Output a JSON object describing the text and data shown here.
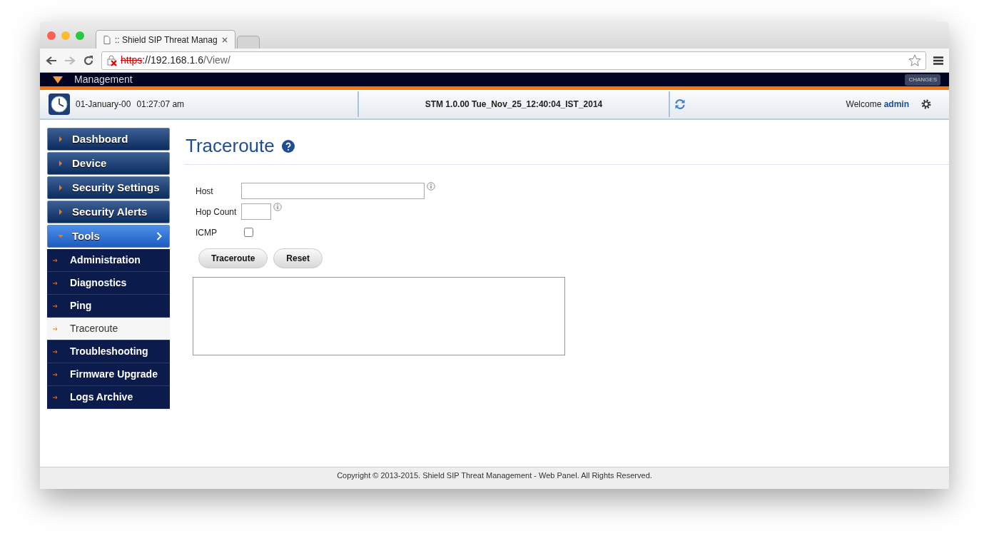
{
  "browser": {
    "tabs": [
      {
        "title": ":: Shield SIP Threat Manag",
        "selected": true
      },
      {
        "selected": false
      }
    ],
    "url": {
      "scheme": "https",
      "host": "://192.168.1.6",
      "path": "/View/"
    }
  },
  "header": {
    "brand": "Management",
    "changes_button": "CHANGES"
  },
  "info_bar": {
    "date": "01-January-00",
    "time": "01:27:07 am",
    "version": "STM 1.0.00 Tue_Nov_25_12:40:04_IST_2014",
    "welcome": "Welcome",
    "user": "admin"
  },
  "sidebar": {
    "items": [
      {
        "label": "Dashboard",
        "expanded": false
      },
      {
        "label": "Device",
        "expanded": false
      },
      {
        "label": "Security Settings",
        "expanded": false
      },
      {
        "label": "Security Alerts",
        "expanded": false
      },
      {
        "label": "Tools",
        "expanded": true,
        "children": [
          {
            "label": "Administration",
            "selected": false
          },
          {
            "label": "Diagnostics",
            "selected": false
          },
          {
            "label": "Ping",
            "selected": false
          },
          {
            "label": "Traceroute",
            "selected": true
          },
          {
            "label": "Troubleshooting",
            "selected": false
          },
          {
            "label": "Firmware Upgrade",
            "selected": false
          },
          {
            "label": "Logs Archive",
            "selected": false
          }
        ]
      }
    ]
  },
  "page": {
    "title": "Traceroute",
    "fields": [
      {
        "kind": "text",
        "label": "Host"
      },
      {
        "kind": "text",
        "label": "Hop Count"
      },
      {
        "kind": "checkbox",
        "label": "ICMP",
        "checked": false
      }
    ],
    "buttons": [
      "Traceroute",
      "Reset"
    ]
  },
  "footer": "Copyright © 2013-2015. Shield SIP Threat Management - Web Panel. All Rights Reserved."
}
